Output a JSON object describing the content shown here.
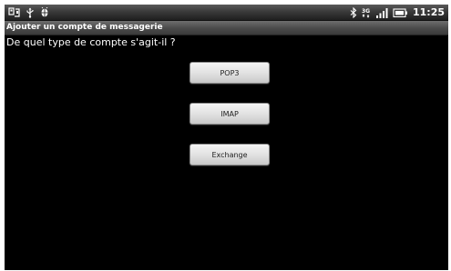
{
  "status_bar": {
    "time": "11:25",
    "left_icons": [
      "usb-debug-icon",
      "usb-icon",
      "android-debug-icon"
    ],
    "right_icons": [
      "bluetooth-icon",
      "3g-signal-icon",
      "signal-bars-icon",
      "battery-icon"
    ]
  },
  "title_bar": {
    "title": "Ajouter un compte de messagerie"
  },
  "main": {
    "question": "De quel type de compte s'agit-il ?",
    "buttons": {
      "pop3": "POP3",
      "imap": "IMAP",
      "exchange": "Exchange"
    }
  },
  "colors": {
    "background": "#000000",
    "text": "#ffffff",
    "button_face": "#e2e2e2",
    "button_text": "#222222"
  }
}
